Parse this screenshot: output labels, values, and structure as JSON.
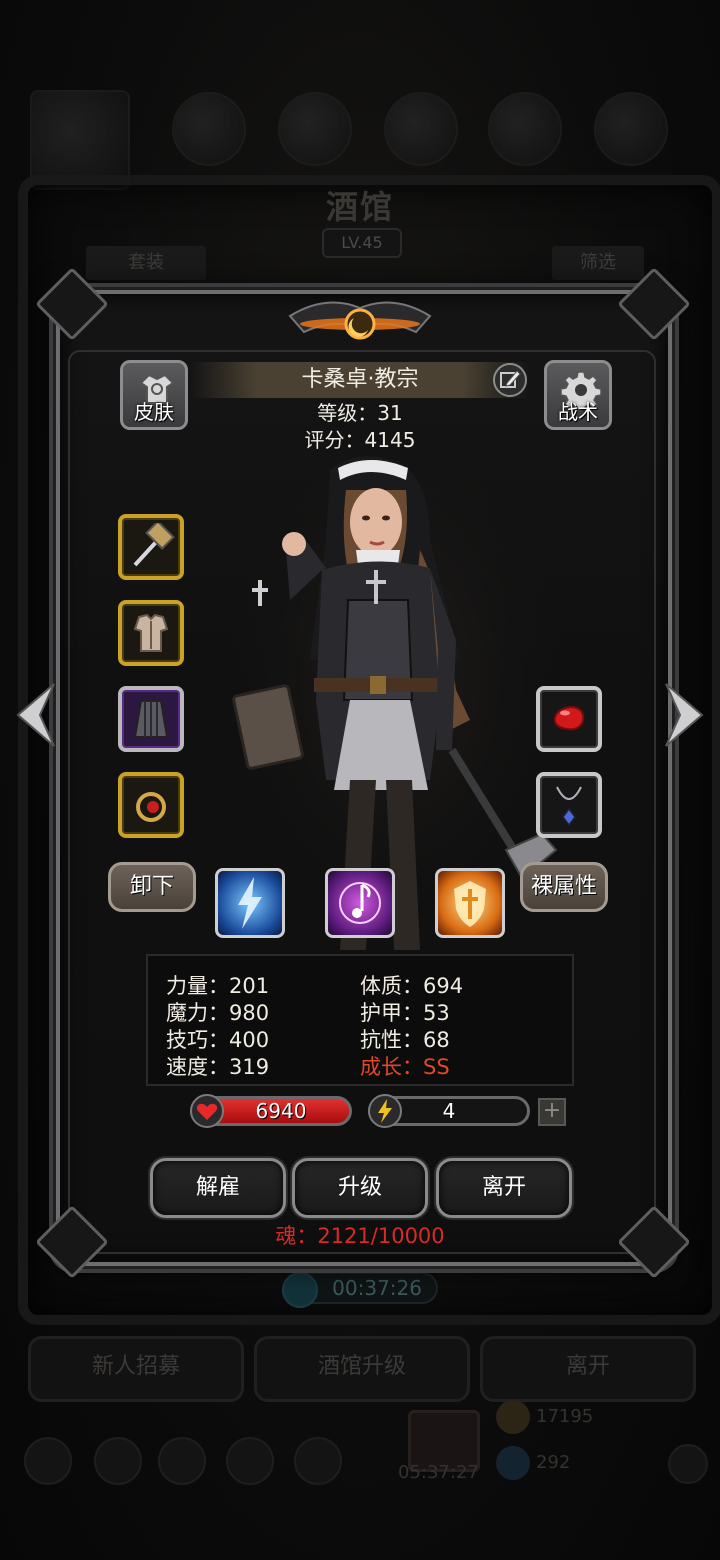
{
  "background": {
    "title": "酒馆",
    "level": "LV.45",
    "tag_left": "套装",
    "tag_right": "筛选",
    "timer": "00:37:26",
    "buttons": [
      "新人招募",
      "酒馆升级",
      "离开"
    ],
    "resource_gold": "17195",
    "resource_gem": "292",
    "gift_timer": "05:37:27"
  },
  "hero": {
    "name": "卡桑卓·教宗",
    "level_text": "等级：31",
    "score_text": "评分：4145"
  },
  "side_buttons": {
    "skin": "皮肤",
    "tactics": "战术"
  },
  "equipment": {
    "left": [
      {
        "icon": "hammer-icon",
        "rarity": "gold"
      },
      {
        "icon": "armor-icon",
        "rarity": "gold"
      },
      {
        "icon": "cloak-icon",
        "rarity": "purple"
      },
      {
        "icon": "ring-icon",
        "rarity": "gold"
      }
    ],
    "right": [
      {
        "icon": "red-gem-icon",
        "rarity": "silver"
      },
      {
        "icon": "necklace-icon",
        "rarity": "silver"
      }
    ]
  },
  "buttons": {
    "unequip": "卸下",
    "base_attr": "裸属性"
  },
  "skills": [
    {
      "icon": "lightning-skill-icon"
    },
    {
      "icon": "music-skill-icon"
    },
    {
      "icon": "holy-shield-skill-icon"
    }
  ],
  "stats": {
    "strength": "力量：201",
    "magic": "魔力：980",
    "skill": "技巧：400",
    "speed": "速度：319",
    "constitution": "体质：694",
    "armor": "护甲：53",
    "resistance": "抗性：68",
    "growth": "成长：SS"
  },
  "vitals": {
    "hp": "6940",
    "energy": "4",
    "plus": "+"
  },
  "actions": {
    "dismiss": "解雇",
    "upgrade": "升级",
    "leave": "离开"
  },
  "soul": "魂：2121/10000",
  "colors": {
    "gold_frame": "#c9a227",
    "growth_red": "#e0482a",
    "soul_red": "#d82a26",
    "hp_red": "#c81a1a"
  }
}
